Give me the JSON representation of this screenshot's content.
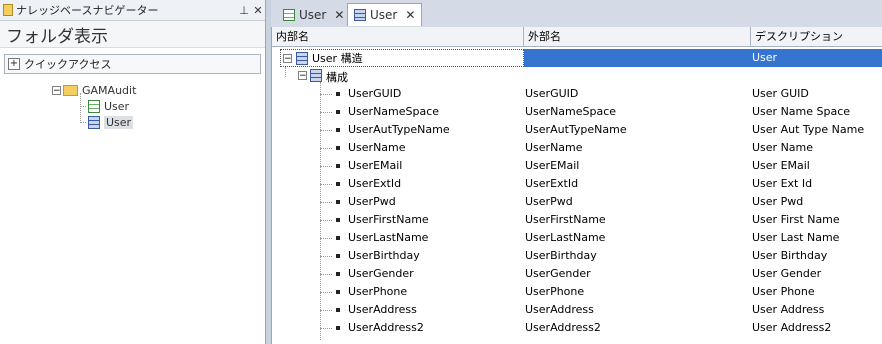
{
  "navigator": {
    "title": "ナレッジベースナビゲーター",
    "pin_icon": "pin-icon",
    "close_icon": "close-icon",
    "folder_view_label": "フォルダ表示",
    "quick_access_label": "クイックアクセス",
    "tree": {
      "folder": "GAMAudit",
      "items": [
        "User",
        "User"
      ]
    }
  },
  "tabs": [
    {
      "label": "User",
      "icon": "table-icon"
    },
    {
      "label": "User",
      "icon": "transaction-icon"
    }
  ],
  "grid": {
    "headers": [
      "内部名",
      "外部名",
      "デスクリプション"
    ],
    "root": {
      "name": "User 構造",
      "description": "User"
    },
    "level": "構成",
    "rows": [
      [
        "UserGUID",
        "UserGUID",
        "User GUID"
      ],
      [
        "UserNameSpace",
        "UserNameSpace",
        "User Name Space"
      ],
      [
        "UserAutTypeName",
        "UserAutTypeName",
        "User Aut Type Name"
      ],
      [
        "UserName",
        "UserName",
        "User Name"
      ],
      [
        "UserEMail",
        "UserEMail",
        "User EMail"
      ],
      [
        "UserExtId",
        "UserExtId",
        "User Ext Id"
      ],
      [
        "UserPwd",
        "UserPwd",
        "User Pwd"
      ],
      [
        "UserFirstName",
        "UserFirstName",
        "User First Name"
      ],
      [
        "UserLastName",
        "UserLastName",
        "User Last Name"
      ],
      [
        "UserBirthday",
        "UserBirthday",
        "User Birthday"
      ],
      [
        "UserGender",
        "UserGender",
        "User Gender"
      ],
      [
        "UserPhone",
        "UserPhone",
        "User Phone"
      ],
      [
        "UserAddress",
        "UserAddress",
        "User Address"
      ],
      [
        "UserAddress2",
        "UserAddress2",
        "User Address2"
      ]
    ]
  },
  "colors": {
    "selection": "#3575cf",
    "panel_bg": "#d4dbe6"
  }
}
